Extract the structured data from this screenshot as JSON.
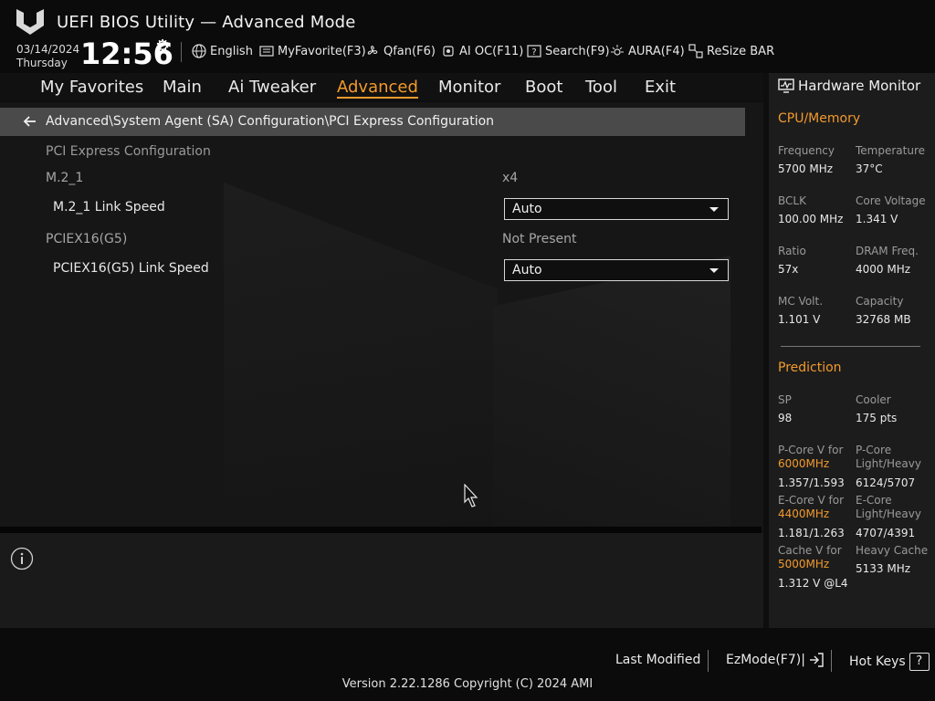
{
  "header": {
    "title": "UEFI BIOS Utility — Advanced Mode",
    "date": "03/14/2024",
    "day": "Thursday",
    "time": "12:56",
    "toolbar": {
      "language": "English",
      "myfavorite": "MyFavorite(F3)",
      "qfan": "Qfan(F6)",
      "aioc": "AI OC(F11)",
      "search": "Search(F9)",
      "aura": "AURA(F4)",
      "resizebar": "ReSize BAR"
    }
  },
  "nav": {
    "tabs": [
      "My Favorites",
      "Main",
      "Ai Tweaker",
      "Advanced",
      "Monitor",
      "Boot",
      "Tool",
      "Exit"
    ],
    "active": "Advanced"
  },
  "main": {
    "breadcrumb": "Advanced\\System Agent (SA) Configuration\\PCI Express Configuration",
    "section_heading": "PCI Express Configuration",
    "m2_label": "M.2_1",
    "m2_value": "x4",
    "m2_speed_label": "M.2_1 Link Speed",
    "m2_speed_value": "Auto",
    "pciex_label": "PCIEX16(G5)",
    "pciex_value": "Not Present",
    "pciex_speed_label": "PCIEX16(G5) Link Speed",
    "pciex_speed_value": "Auto"
  },
  "hw": {
    "title": "Hardware Monitor",
    "cpu_section": "CPU/Memory",
    "frequency_label": "Frequency",
    "frequency_value": "5700 MHz",
    "temperature_label": "Temperature",
    "temperature_value": "37°C",
    "bclk_label": "BCLK",
    "bclk_value": "100.00 MHz",
    "core_voltage_label": "Core Voltage",
    "core_voltage_value": "1.341 V",
    "ratio_label": "Ratio",
    "ratio_value": "57x",
    "dram_label": "DRAM Freq.",
    "dram_value": "4000 MHz",
    "mcvolt_label": "MC Volt.",
    "mcvolt_value": "1.101 V",
    "capacity_label": "Capacity",
    "capacity_value": "32768 MB",
    "prediction_section": "Prediction",
    "sp_label": "SP",
    "sp_value": "98",
    "cooler_label": "Cooler",
    "cooler_value": "175 pts",
    "pcore_v_label": "P-Core V for",
    "pcore_v_freq": "6000MHz",
    "pcore_v_value": "1.357/1.593",
    "pcore_lh_label1": "P-Core",
    "pcore_lh_label2": "Light/Heavy",
    "pcore_lh_value": "6124/5707",
    "ecore_v_label": "E-Core V for",
    "ecore_v_freq": "4400MHz",
    "ecore_v_value": "1.181/1.263",
    "ecore_lh_label1": "E-Core",
    "ecore_lh_label2": "Light/Heavy",
    "ecore_lh_value": "4707/4391",
    "cache_v_label": "Cache V for",
    "cache_v_freq": "5000MHz",
    "cache_v_value": "1.312 V @L4",
    "heavy_cache_label": "Heavy Cache",
    "heavy_cache_value": "5133 MHz"
  },
  "footer": {
    "last_modified": "Last Modified",
    "ezmode": "EzMode(F7)|",
    "hotkeys": "Hot Keys",
    "hotkeys_glyph": "?",
    "version": "Version 2.22.1286 Copyright (C) 2024 AMI"
  },
  "colors": {
    "accent": "#f39a2c",
    "breadcrumb_bar": "#4a4a4a",
    "background": "#0e0e0e"
  }
}
